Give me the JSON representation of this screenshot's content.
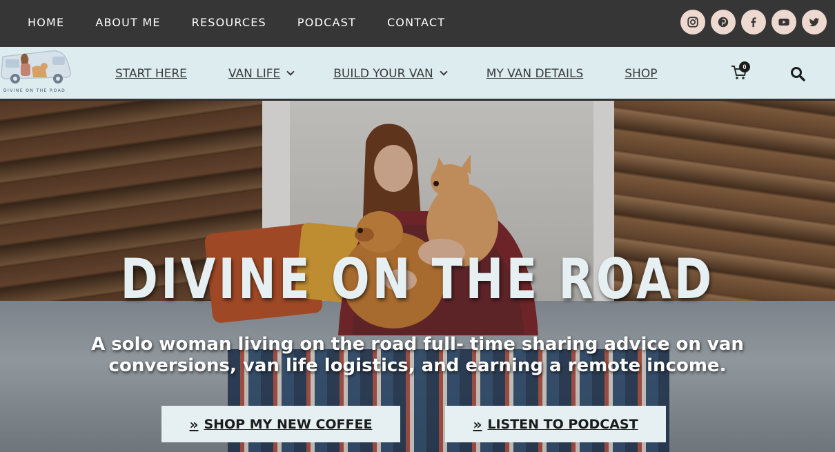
{
  "top_nav": {
    "items": [
      "HOME",
      "ABOUT ME",
      "RESOURCES",
      "PODCAST",
      "CONTACT"
    ],
    "socials": [
      "instagram-icon",
      "pinterest-icon",
      "facebook-icon",
      "youtube-icon",
      "twitter-icon"
    ]
  },
  "main_nav": {
    "logo_text": "DIVINE ON THE ROAD",
    "items": [
      {
        "label": "START HERE",
        "dropdown": false
      },
      {
        "label": "VAN LIFE",
        "dropdown": true
      },
      {
        "label": "BUILD YOUR VAN",
        "dropdown": true
      },
      {
        "label": "MY VAN DETAILS",
        "dropdown": false
      },
      {
        "label": "SHOP",
        "dropdown": false
      }
    ],
    "cart_count": "0"
  },
  "hero": {
    "title": "DIVINE ON THE ROAD",
    "subtitle": "A solo woman living on the road full- time sharing advice on van conversions, van life logistics, and earning a remote income.",
    "buttons": [
      {
        "label": "SHOP MY NEW COFFEE",
        "prefix": "»"
      },
      {
        "label": "LISTEN TO PODCAST",
        "prefix": "»"
      }
    ]
  },
  "colors": {
    "topbar": "#363636",
    "navbar": "#dcecef",
    "social_bg": "#eed9d0",
    "button_bg": "#e6f0f2"
  }
}
